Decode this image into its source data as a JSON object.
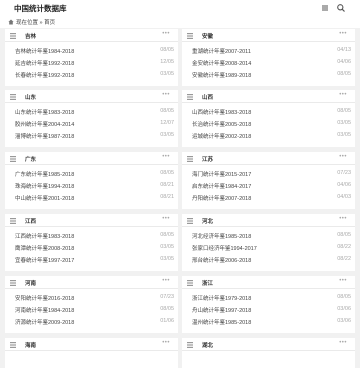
{
  "app": {
    "title": "中国统计数据库"
  },
  "breadcrumb": {
    "prefix": "现在位置",
    "separator": "»",
    "current": "首页"
  },
  "panels": [
    {
      "title": "吉林",
      "items": [
        {
          "label": "吉林统计年鉴1984-2018",
          "date": "08/05"
        },
        {
          "label": "延吉统计年鉴1992-2018",
          "date": "12/05"
        },
        {
          "label": "长春统计年鉴1992-2018",
          "date": "03/05"
        }
      ]
    },
    {
      "title": "安徽",
      "items": [
        {
          "label": "重湖统计年鉴2007-2011",
          "date": "04/13"
        },
        {
          "label": "金安统计年鉴2008-2014",
          "date": "04/06"
        },
        {
          "label": "安徽统计年鉴1989-2018",
          "date": "08/05"
        }
      ]
    },
    {
      "title": "山东",
      "items": [
        {
          "label": "山东统计年鉴1983-2018",
          "date": "08/05"
        },
        {
          "label": "胶州统计年鉴2004-2014",
          "date": "12/07"
        },
        {
          "label": "淄博统计年鉴1987-2018",
          "date": "03/05"
        }
      ]
    },
    {
      "title": "山西",
      "items": [
        {
          "label": "山西统计年鉴1983-2018",
          "date": "08/05"
        },
        {
          "label": "长治统计年鉴2005-2018",
          "date": "03/05"
        },
        {
          "label": "运城统计年鉴2002-2018",
          "date": "03/05"
        }
      ]
    },
    {
      "title": "广东",
      "items": [
        {
          "label": "广东统计年鉴1985-2018",
          "date": "08/05"
        },
        {
          "label": "珠海统计年鉴1994-2018",
          "date": "08/21"
        },
        {
          "label": "中山统计年鉴2001-2018",
          "date": "08/21"
        }
      ]
    },
    {
      "title": "江苏",
      "items": [
        {
          "label": "海门统计年鉴2015-2017",
          "date": "07/23"
        },
        {
          "label": "启东统计年鉴1984-2017",
          "date": "04/06"
        },
        {
          "label": "丹阳统计年鉴2007-2018",
          "date": "04/03"
        }
      ]
    },
    {
      "title": "江西",
      "items": [
        {
          "label": "江西统计年鉴1983-2018",
          "date": "08/05"
        },
        {
          "label": "鹰潭统计年鉴2008-2018",
          "date": "03/05"
        },
        {
          "label": "宜春统计年鉴1997-2017",
          "date": "03/05"
        }
      ]
    },
    {
      "title": "河北",
      "items": [
        {
          "label": "河北经济年鉴1985-2018",
          "date": "08/05"
        },
        {
          "label": "张家口经济年鉴1994-2017",
          "date": "08/22"
        },
        {
          "label": "邢台统计年鉴2006-2018",
          "date": "08/22"
        }
      ]
    },
    {
      "title": "河南",
      "items": [
        {
          "label": "安阳统计年鉴2016-2018",
          "date": "07/23"
        },
        {
          "label": "河南统计年鉴1984-2018",
          "date": "08/05"
        },
        {
          "label": "济源统计年鉴2009-2018",
          "date": "01/06"
        }
      ]
    },
    {
      "title": "浙江",
      "items": [
        {
          "label": "浙江统计年鉴1979-2018",
          "date": "08/05"
        },
        {
          "label": "舟山统计年鉴1997-2018",
          "date": "03/06"
        },
        {
          "label": "温州统计年鉴1985-2018",
          "date": "03/06"
        }
      ]
    },
    {
      "title": "海南",
      "items": []
    },
    {
      "title": "湖北",
      "items": []
    }
  ]
}
